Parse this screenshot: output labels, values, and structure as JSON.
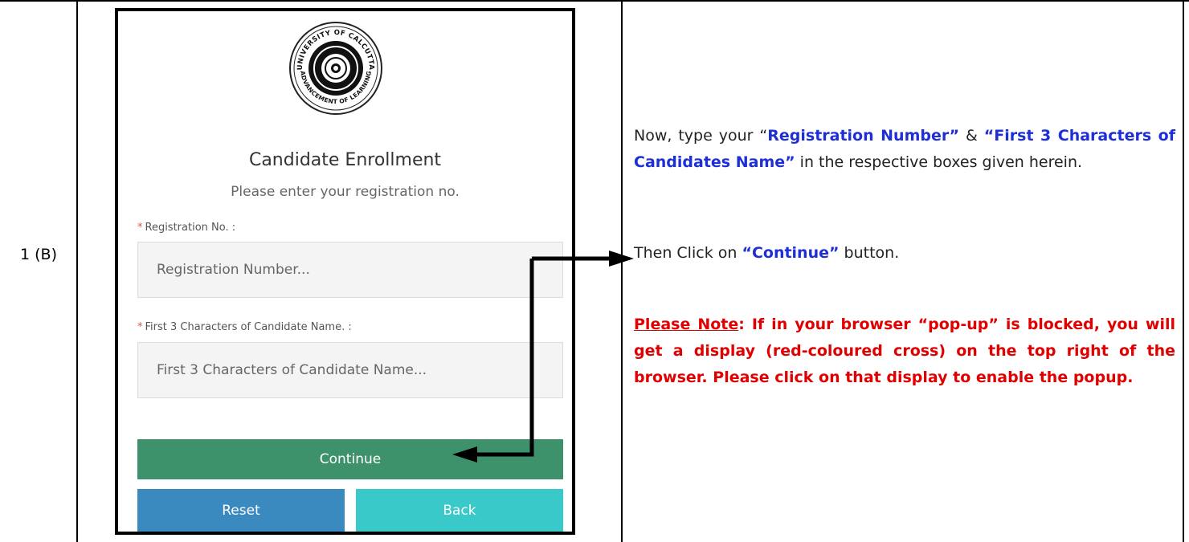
{
  "row": {
    "step": "1 (B)"
  },
  "form": {
    "seal_text_top": "UNIVERSITY OF CALCUTTA",
    "seal_text_bottom": "ADVANCEMENT OF LEARNING",
    "title": "Candidate Enrollment",
    "subtitle": "Please enter your registration no.",
    "registration_label": "Registration No. :",
    "registration_placeholder": "Registration Number...",
    "name_label": "First 3 Characters of Candidate Name. :",
    "name_placeholder": "First 3 Characters of Candidate Name...",
    "required_mark": "*",
    "continue_label": "Continue",
    "reset_label": "Reset",
    "back_label": "Back"
  },
  "instructions": {
    "p1_a": "Now, type your “",
    "p1_b": "Registration Number”",
    "p1_c": " & ",
    "p1_d": "“First 3 Characters of Candidates Name”",
    "p1_e": " in the respective boxes given herein.",
    "p2_a": "Then Click on ",
    "p2_b": "“Continue”",
    "p2_c": " button.",
    "p3_a": "Please Note",
    "p3_b": ": If in your browser “pop-up” is blocked, you will get a display (red-coloured cross) on the top right of the browser. Please click on that display to enable the popup."
  },
  "colors": {
    "continue": "#3e926b",
    "reset": "#3a89bf",
    "back": "#39c9c9",
    "highlight_blue": "#1f2fd6",
    "note_red": "#e00000"
  }
}
